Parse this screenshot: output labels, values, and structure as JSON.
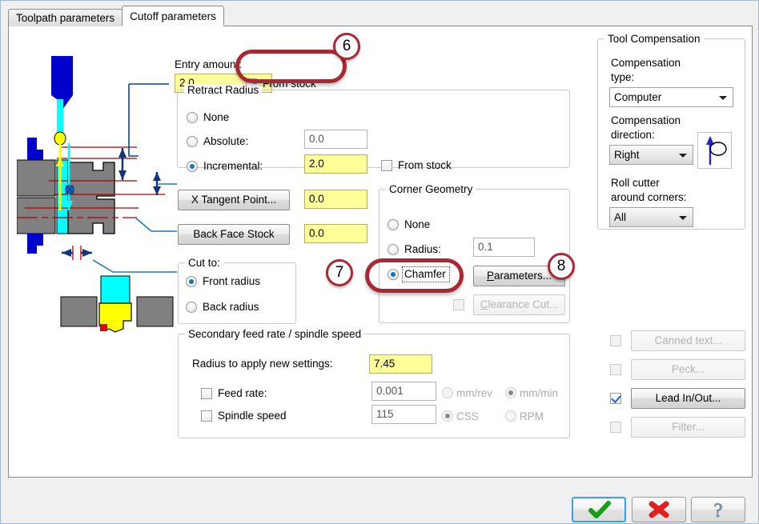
{
  "tabs": [
    {
      "label": "Toolpath parameters",
      "active": false
    },
    {
      "label": "Cutoff parameters",
      "active": true
    }
  ],
  "entry": {
    "label": "Entry amount:",
    "value": "2.0",
    "from_stock_label": "From stock",
    "from_stock_checked": true
  },
  "retract_radius": {
    "title": "Retract Radius",
    "options": [
      {
        "label": "None",
        "selected": false
      },
      {
        "label": "Absolute:",
        "selected": false
      },
      {
        "label": "Incremental:",
        "selected": true
      }
    ],
    "absolute_value": "0.0",
    "incremental_value": "2.0",
    "from_stock_label": "From stock",
    "from_stock_checked": false
  },
  "tangent": {
    "x_tangent_button": "X Tangent Point...",
    "x_tangent_value": "0.0",
    "back_face_button": "Back Face Stock",
    "back_face_value": "0.0"
  },
  "cut_to": {
    "title": "Cut to:",
    "options": [
      {
        "label": "Front radius",
        "selected": true
      },
      {
        "label": "Back radius",
        "selected": false
      }
    ]
  },
  "corner_geometry": {
    "title": "Corner Geometry",
    "options": [
      {
        "label": "None",
        "selected": false
      },
      {
        "label": "Radius:",
        "selected": false
      },
      {
        "label": "Chamfer",
        "selected": true
      }
    ],
    "radius_value": "0.1",
    "parameters_button": "Parameters...",
    "parameters_accel": "P",
    "clearance_cut_button": "Clearance Cut...",
    "clearance_cut_accel": "C",
    "clearance_cut_checked": false,
    "clearance_cut_enabled": false
  },
  "secondary": {
    "title": "Secondary feed rate / spindle speed",
    "radius_label": "Radius to apply new settings:",
    "radius_value": "7.45",
    "feed_rate_label": "Feed rate:",
    "feed_rate_checked": false,
    "feed_rate_value": "0.001",
    "feed_units": [
      {
        "label": "mm/rev",
        "selected": false
      },
      {
        "label": "mm/min",
        "selected": true
      }
    ],
    "spindle_label": "Spindle speed",
    "spindle_checked": false,
    "spindle_value": "115",
    "spindle_units": [
      {
        "label": "CSS",
        "selected": true
      },
      {
        "label": "RPM",
        "selected": false
      }
    ]
  },
  "tool_compensation": {
    "title": "Tool Compensation",
    "type_label_line1": "Compensation",
    "type_label_line2": "type:",
    "type_value": "Computer",
    "direction_label_line1": "Compensation",
    "direction_label_line2": "direction:",
    "direction_value": "Right",
    "roll_label_line1": "Roll cutter",
    "roll_label_line2": "around corners:",
    "roll_value": "All"
  },
  "side_buttons": [
    {
      "label": "Canned text...",
      "checked": false,
      "enabled": false
    },
    {
      "label": "Peck...",
      "checked": false,
      "enabled": false
    },
    {
      "label": "Lead In/Out...",
      "checked": true,
      "enabled": true
    },
    {
      "label": "Filter...",
      "checked": false,
      "enabled": false
    }
  ],
  "action_buttons": [
    {
      "name": "ok",
      "icon": "check-icon",
      "focused": true
    },
    {
      "name": "cancel",
      "icon": "cross-icon",
      "focused": false
    },
    {
      "name": "help",
      "icon": "question-icon",
      "focused": false
    }
  ],
  "annotations": [
    {
      "number": "6"
    },
    {
      "number": "7"
    },
    {
      "number": "8"
    }
  ],
  "colors": {
    "annotation_red": "#a82835",
    "highlight_yellow": "#ffff99",
    "radio_blue": "#1a74b8",
    "focus_blue": "#3c9fd6",
    "tool_blue": "#0000cc",
    "tool_cyan": "#00ffff",
    "tool_yellow": "#ffff00",
    "stock_grey": "#808080",
    "dim_red": "#aa0000"
  }
}
